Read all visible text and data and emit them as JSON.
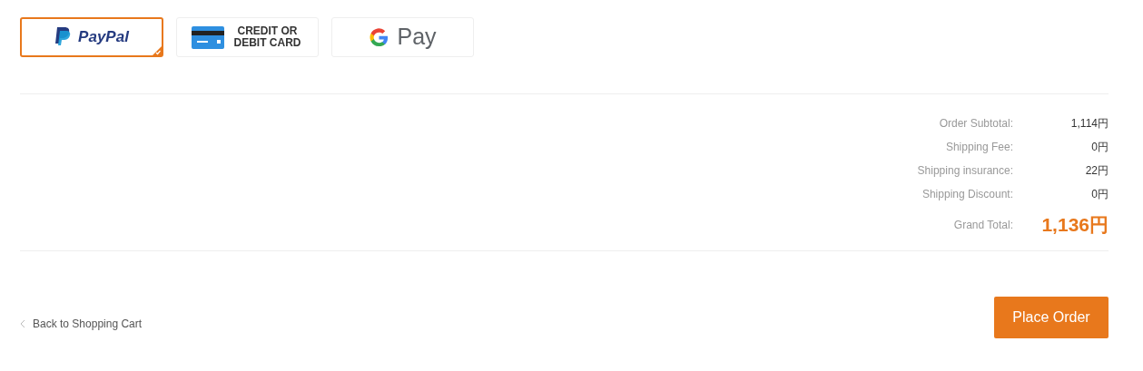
{
  "payment_methods": [
    {
      "kind": "paypal",
      "label": "PayPal",
      "selected": true
    },
    {
      "kind": "card",
      "label": "CREDIT OR DEBIT CARD",
      "selected": false
    },
    {
      "kind": "gpay",
      "label": "Pay",
      "selected": false
    }
  ],
  "summary": [
    {
      "label": "Order Subtotal:",
      "value": "1,114円"
    },
    {
      "label": "Shipping Fee:",
      "value": "0円"
    },
    {
      "label": "Shipping insurance:",
      "value": "22円"
    },
    {
      "label": "Shipping Discount:",
      "value": "0円"
    }
  ],
  "grand_total": {
    "label": "Grand Total:",
    "value": "1,136円"
  },
  "back_link": "Back to Shopping Cart",
  "place_order": "Place Order"
}
